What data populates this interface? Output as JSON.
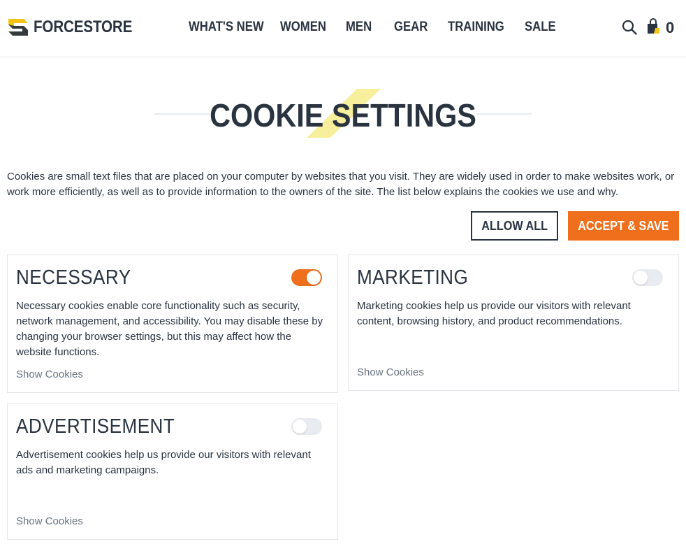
{
  "brand": {
    "name": "FORCESTORE",
    "accent_color": "#f06f1c",
    "logo_color": "#f2c418"
  },
  "nav": {
    "items": [
      {
        "label": "WHAT'S NEW"
      },
      {
        "label": "WOMEN"
      },
      {
        "label": "MEN"
      },
      {
        "label": "GEAR"
      },
      {
        "label": "TRAINING"
      },
      {
        "label": "SALE"
      }
    ],
    "search_icon": "search-icon",
    "cart_icon": "shopping-bag-icon",
    "cart_count": "0"
  },
  "page": {
    "title": "COOKIE SETTINGS",
    "intro": "Cookies are small text files that are placed on your computer by websites that you visit. They are widely used in order to make websites work, or work more efficiently, as well as to provide information to the owners of the site. The list below explains the cookies we use and why."
  },
  "actions": {
    "allow_all": "ALLOW ALL",
    "accept_save": "ACCEPT & SAVE"
  },
  "cards": {
    "necessary": {
      "title": "NECESSARY",
      "enabled": true,
      "description": "Necessary cookies enable core functionality such as security, network management, and accessibility. You may disable these by changing your browser settings, but this may affect how the website functions.",
      "show_link": "Show Cookies"
    },
    "marketing": {
      "title": "MARKETING",
      "enabled": false,
      "description": "Marketing cookies help us provide our visitors with relevant content, browsing history, and product recommendations.",
      "show_link": "Show Cookies"
    },
    "advertisement": {
      "title": "ADVERTISEMENT",
      "enabled": false,
      "description": "Advertisement cookies help us provide our visitors with relevant ads and marketing campaigns.",
      "show_link": "Show Cookies"
    }
  }
}
